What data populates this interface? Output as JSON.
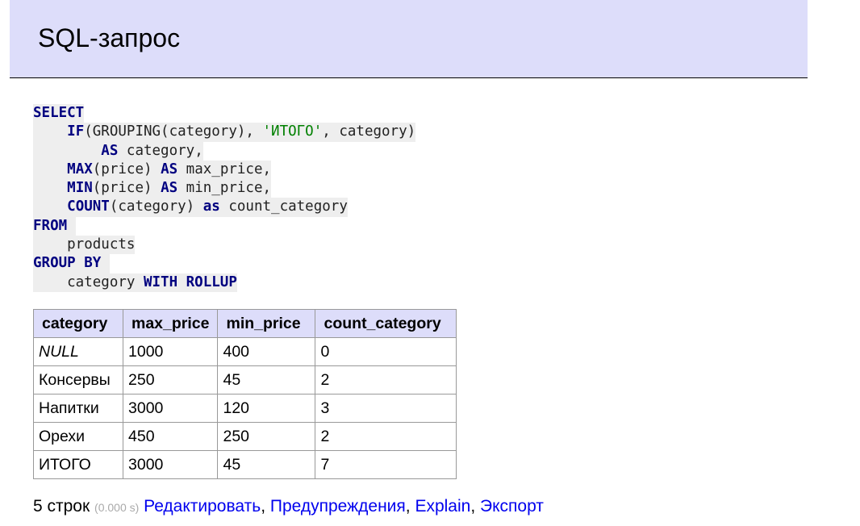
{
  "header": {
    "title": "SQL-запрос"
  },
  "sql": {
    "lines": [
      [
        {
          "t": "SELECT",
          "k": "kw"
        }
      ],
      [
        {
          "t": "    "
        },
        {
          "t": "IF",
          "k": "kw"
        },
        {
          "t": "(GROUPING(category), "
        },
        {
          "t": "'ИТОГО'",
          "k": "str"
        },
        {
          "t": ", category)"
        }
      ],
      [
        {
          "t": "        "
        },
        {
          "t": "AS",
          "k": "kw"
        },
        {
          "t": " category,"
        }
      ],
      [
        {
          "t": "    "
        },
        {
          "t": "MAX",
          "k": "kw"
        },
        {
          "t": "(price) "
        },
        {
          "t": "AS",
          "k": "kw"
        },
        {
          "t": " max_price,"
        }
      ],
      [
        {
          "t": "    "
        },
        {
          "t": "MIN",
          "k": "kw"
        },
        {
          "t": "(price) "
        },
        {
          "t": "AS",
          "k": "kw"
        },
        {
          "t": " min_price,"
        }
      ],
      [
        {
          "t": "    "
        },
        {
          "t": "COUNT",
          "k": "kw"
        },
        {
          "t": "(category) "
        },
        {
          "t": "as",
          "k": "kw"
        },
        {
          "t": " count_category"
        }
      ],
      [
        {
          "t": "FROM",
          "k": "kw"
        },
        {
          "t": " "
        }
      ],
      [
        {
          "t": "    products"
        }
      ],
      [
        {
          "t": "GROUP BY",
          "k": "kw"
        },
        {
          "t": " "
        }
      ],
      [
        {
          "t": "    category "
        },
        {
          "t": "WITH ROLLUP",
          "k": "kw"
        }
      ]
    ]
  },
  "table": {
    "columns": [
      "category",
      "max_price",
      "min_price",
      "count_category"
    ],
    "rows": [
      [
        "NULL",
        "1000",
        "400",
        "0"
      ],
      [
        "Консервы",
        "250",
        "45",
        "2"
      ],
      [
        "Напитки",
        "3000",
        "120",
        "3"
      ],
      [
        "Орехи",
        "450",
        "250",
        "2"
      ],
      [
        "ИТОГО",
        "3000",
        "45",
        "7"
      ]
    ]
  },
  "footer": {
    "rows_count": "5 строк",
    "time": "(0.000 s)",
    "links": [
      "Редактировать",
      "Предупреждения",
      "Explain",
      "Экспорт"
    ],
    "separator": ", "
  }
}
